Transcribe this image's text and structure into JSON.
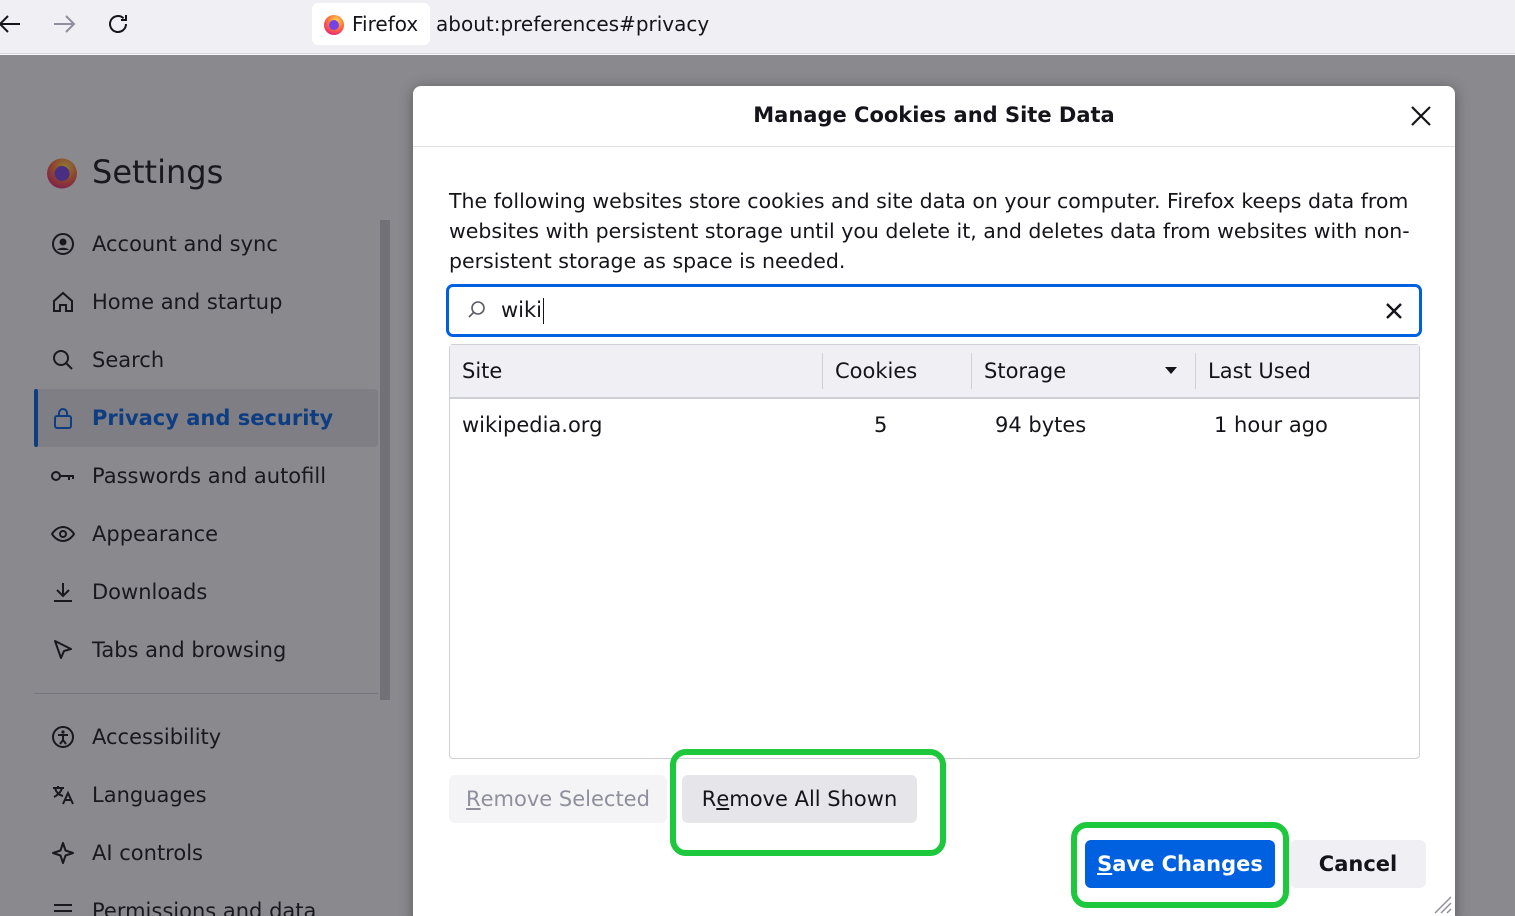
{
  "browser": {
    "identity_label": "Firefox",
    "url": "about:preferences#privacy"
  },
  "settings": {
    "title": "Settings",
    "nav_items": [
      {
        "label": "Account and sync",
        "icon": "account-icon"
      },
      {
        "label": "Home and startup",
        "icon": "home-icon"
      },
      {
        "label": "Search",
        "icon": "search-icon"
      },
      {
        "label": "Privacy and security",
        "icon": "lock-icon",
        "active": true
      },
      {
        "label": "Passwords and autofill",
        "icon": "key-icon"
      },
      {
        "label": "Appearance",
        "icon": "eye-icon"
      },
      {
        "label": "Downloads",
        "icon": "download-icon"
      },
      {
        "label": "Tabs and browsing",
        "icon": "cursor-icon"
      }
    ],
    "nav_items_secondary": [
      {
        "label": "Accessibility",
        "icon": "accessibility-icon"
      },
      {
        "label": "Languages",
        "icon": "translate-icon"
      },
      {
        "label": "AI controls",
        "icon": "sparkle-icon"
      },
      {
        "label": "Permissions and data",
        "icon": "sliders-icon"
      }
    ]
  },
  "dialog": {
    "title": "Manage Cookies and Site Data",
    "description": "The following websites store cookies and site data on your computer. Firefox keeps data from websites with persistent storage until you delete it, and deletes data from websites with non-persistent storage as space is needed.",
    "search_value": "wiki",
    "columns": [
      "Site",
      "Cookies",
      "Storage",
      "Last Used"
    ],
    "rows": [
      {
        "site": "wikipedia.org",
        "cookies": "5",
        "storage": "94 bytes",
        "last_used": "1 hour ago"
      }
    ],
    "buttons": {
      "remove_selected": {
        "accesskey": "R",
        "rest": "emove Selected"
      },
      "remove_all": {
        "pre": "R",
        "accesskey": "e",
        "rest": "move All Shown"
      },
      "save": {
        "accesskey": "S",
        "rest": "ave Changes"
      },
      "cancel": "Cancel"
    }
  },
  "colors": {
    "accent": "#0061e0",
    "highlight": "#1ec83c"
  }
}
